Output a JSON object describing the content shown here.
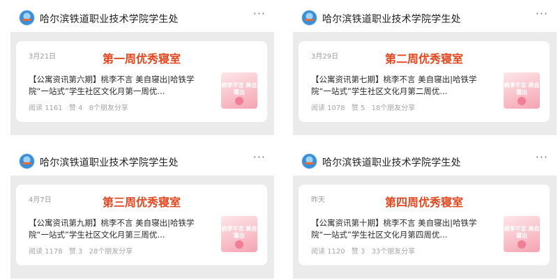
{
  "posts": [
    {
      "account": "哈尔滨铁道职业技术学院学生处",
      "more": "···",
      "date": "3月21日",
      "title": "第一周优秀寝室",
      "desc": "【公寓资讯第六期】桃李不言 美自寝出|哈铁学院“一站式”学生社区文化月第一周优...",
      "reads": "阅读 1161",
      "likes": "赞 4",
      "shares": "8个朋友分享",
      "thumb_text": "桃李不言 美自寝出"
    },
    {
      "account": "哈尔滨铁道职业技术学院学生处",
      "more": "···",
      "date": "3月29日",
      "title": "第二周优秀寝室",
      "desc": "【公寓资讯第七期】桃李不言 美自寝出|哈铁学院“一站式”学生社区文化月第二周优...",
      "reads": "阅读 1078",
      "likes": "赞 5",
      "shares": "18个朋友分享",
      "thumb_text": "桃李不言 美自寝出"
    },
    {
      "account": "哈尔滨铁道职业技术学院学生处",
      "more": "···",
      "date": "4月7日",
      "title": "第三周优秀寝室",
      "desc": "【公寓资讯第九期】桃李不言 美自寝出|哈铁学院“一站式”学生社区文化月第三周优...",
      "reads": "阅读 1178",
      "likes": "赞 3",
      "shares": "28个朋友分享",
      "thumb_text": "桃李不言 美自寝出"
    },
    {
      "account": "哈尔滨铁道职业技术学院学生处",
      "more": "···",
      "date": "昨天",
      "title": "第四周优秀寝室",
      "desc": "【公寓资讯第十期】桃李不言 美自寝出|哈铁学院“一站式”学生社区文化月第四周优...",
      "reads": "阅读 1120",
      "likes": "赞 3",
      "shares": "33个朋友分享",
      "thumb_text": "桃李不言 美自寝出"
    }
  ]
}
